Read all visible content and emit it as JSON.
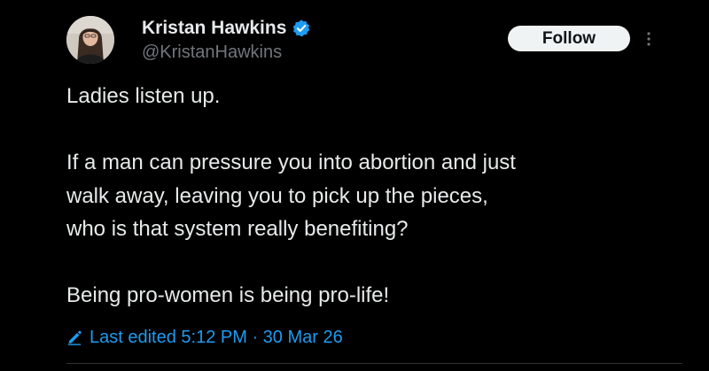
{
  "author": {
    "display_name": "Kristan Hawkins",
    "handle": "@KristanHawkins",
    "verified": true,
    "verified_icon": "verified-badge-icon",
    "avatar_icon": "profile-photo"
  },
  "actions": {
    "follow_label": "Follow",
    "more_icon": "more-vertical-icon"
  },
  "tweet": {
    "paragraphs": [
      [
        "Ladies listen up."
      ],
      [
        "If a man can pressure you into abortion and just",
        "walk away, leaving you to pick up the pieces,",
        "who is that system really benefiting?"
      ],
      [
        "Being pro-women is being pro-life!"
      ]
    ],
    "line_1": "Ladies listen up.",
    "line_2": "If a man can pressure you into abortion and just",
    "line_3": "walk away, leaving you to pick up the pieces,",
    "line_4": "who is that system really benefiting?",
    "line_5": "Being pro-women is being pro-life!"
  },
  "edited": {
    "icon": "pencil-icon",
    "label": "Last edited 5:12 PM · 30 Mar 26"
  },
  "colors": {
    "background": "#000000",
    "text_primary": "#e7e9ea",
    "text_secondary": "#71767b",
    "accent": "#1d9bf0",
    "follow_bg": "#eff3f4",
    "divider": "#2f3336"
  }
}
